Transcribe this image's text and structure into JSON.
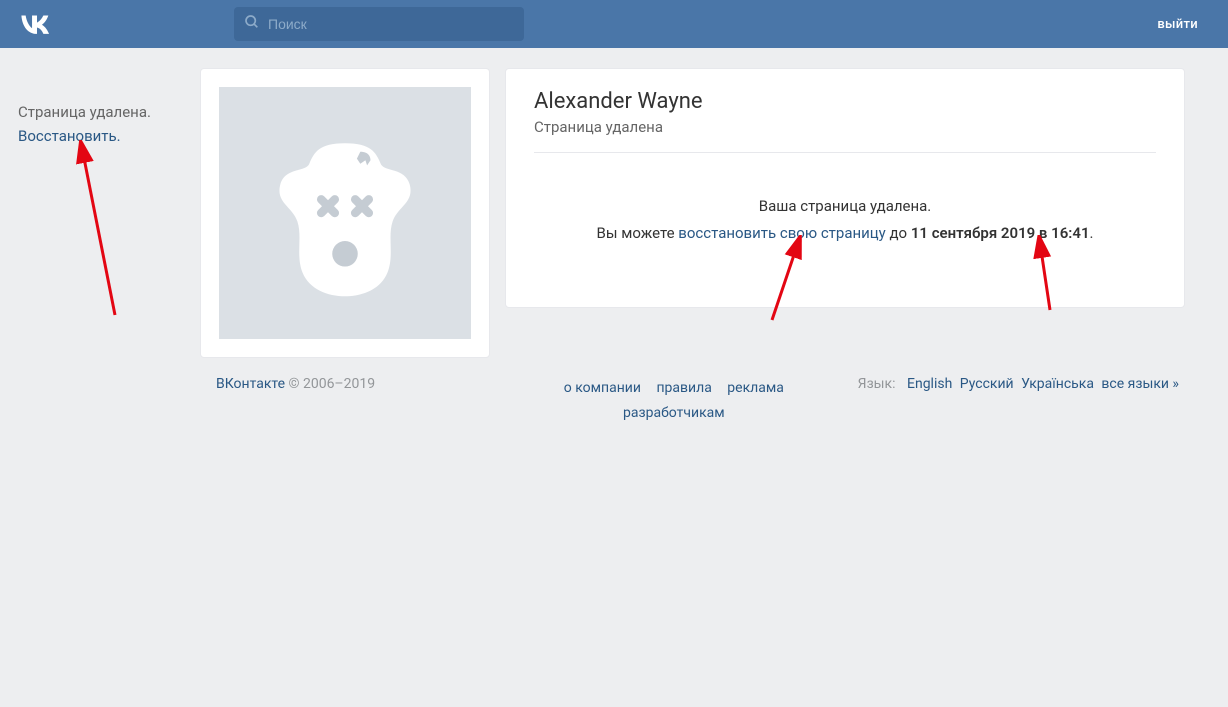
{
  "header": {
    "search_placeholder": "Поиск",
    "logout_label": "выйти"
  },
  "sidebar": {
    "deleted_text": "Страница удалена.",
    "restore_label": "Восстановить."
  },
  "profile": {
    "name": "Alexander Wayne",
    "status": "Страница удалена",
    "deleted_heading": "Ваша страница удалена.",
    "restore_prefix": "Вы можете ",
    "restore_link_text": "восстановить свою страницу",
    "restore_middle": " до ",
    "restore_deadline": "11 сентября 2019 в 16:41",
    "restore_suffix": "."
  },
  "footer": {
    "brand": "ВКонтакте",
    "copyright": " © 2006–2019",
    "links": {
      "about": "о компании",
      "rules": "правила",
      "ads": "реклама",
      "devs": "разработчикам"
    },
    "lang_label": "Язык:",
    "langs": {
      "en": "English",
      "ru": "Русский",
      "uk": "Українська",
      "all": "все языки »"
    }
  }
}
